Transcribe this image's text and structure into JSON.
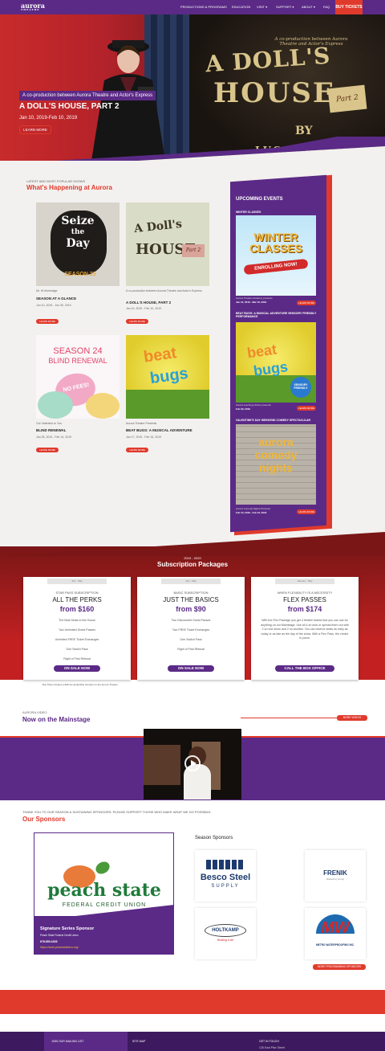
{
  "nav": {
    "logo": "aurora",
    "logo_sub": "THEATRE",
    "items": [
      "PRODUCTIONS & PROGRAMS",
      "EDUCATION",
      "VISIT",
      "SUPPORT",
      "ABOUT",
      "FAQ"
    ],
    "buy": "BUY TICKETS"
  },
  "hero": {
    "kicker": "A co-production between Aurora Theatre and Actor's Express",
    "title": "A DOLL'S HOUSE, PART 2",
    "dates": "Jan 10, 2019-Feb 10, 2019",
    "button": "LEARN MORE",
    "poster_small": "A co-production between Aurora Theatre and Actor's Express",
    "poster_line1": "A DOLL'S",
    "poster_line2": "HOUSE",
    "poster_part": "Part 2",
    "poster_by": "BY",
    "poster_author": "LUCAS HNATH"
  },
  "happening": {
    "kicker": "LATEST AND MOST POPULAR SHOWS",
    "title": "What's Happening at Aurora",
    "cards": [
      {
        "art1": "Seize",
        "art2": "the",
        "art3": "Day",
        "art4": "SEASON 25",
        "caption": "Mr. W Morrisidge",
        "title": "SEASON AT A GLANCE",
        "date": "Jun 10, 2019 - Jun 30, 2019",
        "button": "LEARN MORE"
      },
      {
        "art1": "A Doll's",
        "art2": "HOUSE",
        "art3": "Part 2",
        "art4": "",
        "caption": "A co-production between Aurora Theatre and Actor's Express",
        "title": "A DOLL'S HOUSE, PART 2",
        "date": "Jan 10, 2019 - Feb 10, 2019",
        "button": "LEARN MORE"
      },
      {
        "art1": "SEASON 24",
        "art2": "BLIND RENEWAL",
        "art3": "NO FEES!",
        "art4": "",
        "caption": "Our Valentine to You",
        "title": "BLIND RENEWAL",
        "date": "Jan 25, 2019 - Feb 14, 2019",
        "button": "LEARN MORE"
      },
      {
        "art1": "beat",
        "art2": "bugs",
        "art3": "",
        "art4": "",
        "caption": "Aurora Theatre Presents",
        "title": "BEAT BUGS: A MUSICAL ADVENTURE",
        "date": "Jan 17, 2019 - Feb 15, 2019",
        "button": "LEARN MORE"
      }
    ]
  },
  "upcoming": {
    "title": "UPCOMING EVENTS",
    "events": [
      {
        "category": "WINTER CLASSES",
        "art1": "WINTER",
        "art2": "CLASSES",
        "art3": "ENROLLING NOW!",
        "caption": "Aurora Theatre Academy presents",
        "date": "Jan 12, 2019 - Mar 16, 2019",
        "button": "LEARN MORE"
      },
      {
        "category": "BEAT BUGS: A MUSICAL ADVENTURE SENSORY FRIENDLY PERFORMANCE",
        "art1": "beat",
        "art2": "bugs",
        "art3": "SENSORY FRIENDLY",
        "caption": "Aurora Learning Library presents",
        "date": "Feb 09, 2019",
        "button": "LEARN MORE"
      },
      {
        "category": "VALENTINE'S DAY WEEKEND COMEDY SPECTACULAR",
        "art1": "aurora",
        "art2": "comedy",
        "art3": "nights",
        "caption": "Aurora Comedy Nights Presents",
        "date": "Feb 15, 2019 - Feb 16, 2019",
        "button": "LEARN MORE"
      }
    ]
  },
  "subscriptions": {
    "kicker": "2019 - 2020",
    "title": "Subscription Packages",
    "packages": [
      {
        "tab": "July - May",
        "kicker": "STAR PASS SUBSCRIPTION",
        "name": "ALL THE PERKS",
        "price": "from $160",
        "features": [
          "The Best Seats in the House",
          "Two Unlimited Guest Passes",
          "Unlimited FREE Ticket Exchanges",
          "One Switch Pass",
          "Right of First Refusal"
        ],
        "button": "ON SALE NOW"
      },
      {
        "tab": "July - May",
        "kicker": "BASIC SUBSCRIPTION",
        "name": "JUST THE BASICS",
        "price": "from $90",
        "features": [
          "Two Discounted Guest Passes",
          "Two FREE Ticket Exchanges",
          "One Switch Pass",
          "Right of First Refusal"
        ],
        "button": "ON SALE NOW"
      },
      {
        "tab": "January - May",
        "kicker": "WHEN FLEXIBILITY IS A NECESSITY",
        "name": "FLEX PASSES",
        "price": "from $174",
        "description": "With the Flex Package you get 4 flexible tickets that you can use for anything on our Mainstage. Use all 4 at once or spread them out with 2 on one show and 2 on another. You can reserve seats as early as today or as late as the day of the show. With a Flex Pass, the choice is yours.",
        "button": "CALL THE BOX OFFICE"
      }
    ],
    "note": "Star Pass includes a $25 tax-deductible donation to the Aurora Theatre."
  },
  "video": {
    "kicker": "AURORA VIDEO",
    "title": "Now on the Mainstage",
    "button": "MORE VIDEOS"
  },
  "sponsors": {
    "kicker": "THANK YOU TO OUR SEASON & SUSTAINING SPONSORS. PLEASE SUPPORT THOSE WHO MAKE WHAT WE DO POSSIBLE.",
    "title": "Our Sponsors",
    "signature": {
      "logo_main": "peach state",
      "logo_sub": "FEDERAL CREDIT UNION",
      "label": "Signature Series Sponsor",
      "name": "Peach State Federal Credit Union",
      "phone": "678.889.4328",
      "url": "https://www.peachstatefcu.org/"
    },
    "season_title": "Season Sponsors",
    "season": [
      {
        "line1": "Besco Steel",
        "line2": "SUPPLY"
      },
      {
        "line1": "FRENIK",
        "line2": "Marketing Group"
      },
      {
        "line1": "HOLTKAMP",
        "line2": "Heating & Air"
      },
      {
        "line1": "MW",
        "line2": "METRO WATERPROOFING INC."
      }
    ],
    "button": "MORE PROGRAMMING SPONSORS"
  },
  "footer": {
    "col1": "JOIN OUR MAILING LIST",
    "col2": "SITE MAP",
    "col3": "GET IN TOUCH",
    "address": "128 East Pike Street"
  }
}
